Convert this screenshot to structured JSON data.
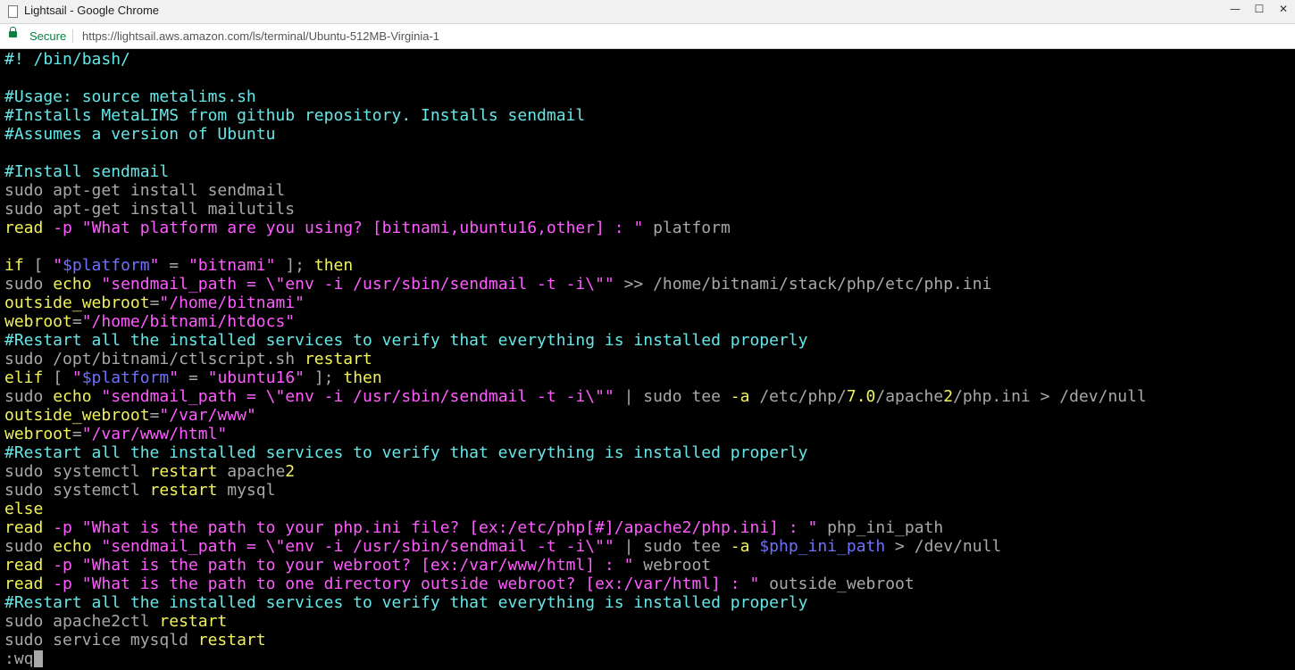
{
  "window": {
    "title": "Lightsail - Google Chrome",
    "controls": {
      "minimize": "—",
      "maximize": "☐",
      "close": "✕"
    }
  },
  "addressbar": {
    "secure_label": "Secure",
    "url": "https://lightsail.aws.amazon.com/ls/terminal/Ubuntu-512MB-Virginia-1"
  },
  "colors": {
    "comment": "#66e6e6",
    "keyword": "#f2f25c",
    "string": "#ff5cff",
    "plain": "#a8a8a8",
    "variable": "#7070ff",
    "background": "#000000"
  },
  "terminal": {
    "lines": [
      [
        {
          "t": "#! /bin/bash/",
          "c": "comment"
        }
      ],
      [],
      [
        {
          "t": "#Usage: source metalims.sh",
          "c": "comment"
        }
      ],
      [
        {
          "t": "#Installs MetaLIMS from github repository. Installs sendmail",
          "c": "comment"
        }
      ],
      [
        {
          "t": "#Assumes a version of Ubuntu",
          "c": "comment"
        }
      ],
      [],
      [
        {
          "t": "#Install sendmail",
          "c": "comment"
        }
      ],
      [
        {
          "t": "sudo apt-get install sendmail",
          "c": "plain"
        }
      ],
      [
        {
          "t": "sudo apt-get install mailutils",
          "c": "plain"
        }
      ],
      [
        {
          "t": "read",
          "c": "keyword"
        },
        {
          "t": " ",
          "c": "plain"
        },
        {
          "t": "-p",
          "c": "string"
        },
        {
          "t": " ",
          "c": "plain"
        },
        {
          "t": "\"What platform are you using? [bitnami,ubuntu16,other] : \"",
          "c": "string"
        },
        {
          "t": " platform",
          "c": "plain"
        }
      ],
      [],
      [
        {
          "t": "if",
          "c": "keyword"
        },
        {
          "t": " [ ",
          "c": "plain"
        },
        {
          "t": "\"",
          "c": "string"
        },
        {
          "t": "$platform",
          "c": "variable"
        },
        {
          "t": "\"",
          "c": "string"
        },
        {
          "t": " = ",
          "c": "plain"
        },
        {
          "t": "\"bitnami\"",
          "c": "string"
        },
        {
          "t": " ]; ",
          "c": "plain"
        },
        {
          "t": "then",
          "c": "keyword"
        }
      ],
      [
        {
          "t": "sudo ",
          "c": "plain"
        },
        {
          "t": "echo",
          "c": "keyword"
        },
        {
          "t": " ",
          "c": "plain"
        },
        {
          "t": "\"sendmail_path = \\\"env -i /usr/sbin/sendmail -t -i\\\"\"",
          "c": "string"
        },
        {
          "t": " >> /home/bitnami/stack/php/etc/php.ini",
          "c": "plain"
        }
      ],
      [
        {
          "t": "outside_webroot",
          "c": "keyword"
        },
        {
          "t": "=",
          "c": "plain"
        },
        {
          "t": "\"/home/bitnami\"",
          "c": "string"
        }
      ],
      [
        {
          "t": "webroot",
          "c": "keyword"
        },
        {
          "t": "=",
          "c": "plain"
        },
        {
          "t": "\"/home/bitnami/htdocs\"",
          "c": "string"
        }
      ],
      [
        {
          "t": "#Restart all the installed services to verify that everything is installed properly",
          "c": "comment"
        }
      ],
      [
        {
          "t": "sudo /opt/bitnami/ctlscript.sh ",
          "c": "plain"
        },
        {
          "t": "restart",
          "c": "keyword"
        }
      ],
      [
        {
          "t": "elif",
          "c": "keyword"
        },
        {
          "t": " [ ",
          "c": "plain"
        },
        {
          "t": "\"",
          "c": "string"
        },
        {
          "t": "$platform",
          "c": "variable"
        },
        {
          "t": "\"",
          "c": "string"
        },
        {
          "t": " = ",
          "c": "plain"
        },
        {
          "t": "\"ubuntu16\"",
          "c": "string"
        },
        {
          "t": " ]; ",
          "c": "plain"
        },
        {
          "t": "then",
          "c": "keyword"
        }
      ],
      [
        {
          "t": "sudo ",
          "c": "plain"
        },
        {
          "t": "echo",
          "c": "keyword"
        },
        {
          "t": " ",
          "c": "plain"
        },
        {
          "t": "\"sendmail_path = \\\"env -i /usr/sbin/sendmail -t -i\\\"\"",
          "c": "string"
        },
        {
          "t": " | sudo tee ",
          "c": "plain"
        },
        {
          "t": "-a",
          "c": "keyword"
        },
        {
          "t": " /etc/php/",
          "c": "plain"
        },
        {
          "t": "7.0",
          "c": "keyword"
        },
        {
          "t": "/apache",
          "c": "plain"
        },
        {
          "t": "2",
          "c": "keyword"
        },
        {
          "t": "/php.ini > /dev/null",
          "c": "plain"
        }
      ],
      [
        {
          "t": "outside_webroot",
          "c": "keyword"
        },
        {
          "t": "=",
          "c": "plain"
        },
        {
          "t": "\"/var/www\"",
          "c": "string"
        }
      ],
      [
        {
          "t": "webroot",
          "c": "keyword"
        },
        {
          "t": "=",
          "c": "plain"
        },
        {
          "t": "\"/var/www/html\"",
          "c": "string"
        }
      ],
      [
        {
          "t": "#Restart all the installed services to verify that everything is installed properly",
          "c": "comment"
        }
      ],
      [
        {
          "t": "sudo systemctl ",
          "c": "plain"
        },
        {
          "t": "restart",
          "c": "keyword"
        },
        {
          "t": " apache",
          "c": "plain"
        },
        {
          "t": "2",
          "c": "keyword"
        }
      ],
      [
        {
          "t": "sudo systemctl ",
          "c": "plain"
        },
        {
          "t": "restart",
          "c": "keyword"
        },
        {
          "t": " mysql",
          "c": "plain"
        }
      ],
      [
        {
          "t": "else",
          "c": "keyword"
        }
      ],
      [
        {
          "t": "read",
          "c": "keyword"
        },
        {
          "t": " ",
          "c": "plain"
        },
        {
          "t": "-p",
          "c": "string"
        },
        {
          "t": " ",
          "c": "plain"
        },
        {
          "t": "\"What is the path to your php.ini file? [ex:/etc/php[#]/apache2/php.ini] : \"",
          "c": "string"
        },
        {
          "t": " php_ini_path",
          "c": "plain"
        }
      ],
      [
        {
          "t": "sudo ",
          "c": "plain"
        },
        {
          "t": "echo",
          "c": "keyword"
        },
        {
          "t": " ",
          "c": "plain"
        },
        {
          "t": "\"sendmail_path = \\\"env -i /usr/sbin/sendmail -t -i\\\"\"",
          "c": "string"
        },
        {
          "t": " | sudo tee ",
          "c": "plain"
        },
        {
          "t": "-a",
          "c": "keyword"
        },
        {
          "t": " ",
          "c": "plain"
        },
        {
          "t": "$php_ini_path",
          "c": "variable"
        },
        {
          "t": " > /dev/null",
          "c": "plain"
        }
      ],
      [
        {
          "t": "read",
          "c": "keyword"
        },
        {
          "t": " ",
          "c": "plain"
        },
        {
          "t": "-p",
          "c": "string"
        },
        {
          "t": " ",
          "c": "plain"
        },
        {
          "t": "\"What is the path to your webroot? [ex:/var/www/html] : \"",
          "c": "string"
        },
        {
          "t": " webroot",
          "c": "plain"
        }
      ],
      [
        {
          "t": "read",
          "c": "keyword"
        },
        {
          "t": " ",
          "c": "plain"
        },
        {
          "t": "-p",
          "c": "string"
        },
        {
          "t": " ",
          "c": "plain"
        },
        {
          "t": "\"What is the path to one directory outside webroot? [ex:/var/html] : \"",
          "c": "string"
        },
        {
          "t": " outside_webroot",
          "c": "plain"
        }
      ],
      [
        {
          "t": "#Restart all the installed services to verify that everything is installed properly",
          "c": "comment"
        }
      ],
      [
        {
          "t": "sudo apache2ctl ",
          "c": "plain"
        },
        {
          "t": "restart",
          "c": "keyword"
        }
      ],
      [
        {
          "t": "sudo service mysqld ",
          "c": "plain"
        },
        {
          "t": "restart",
          "c": "keyword"
        }
      ]
    ],
    "command_line": ":wq"
  }
}
